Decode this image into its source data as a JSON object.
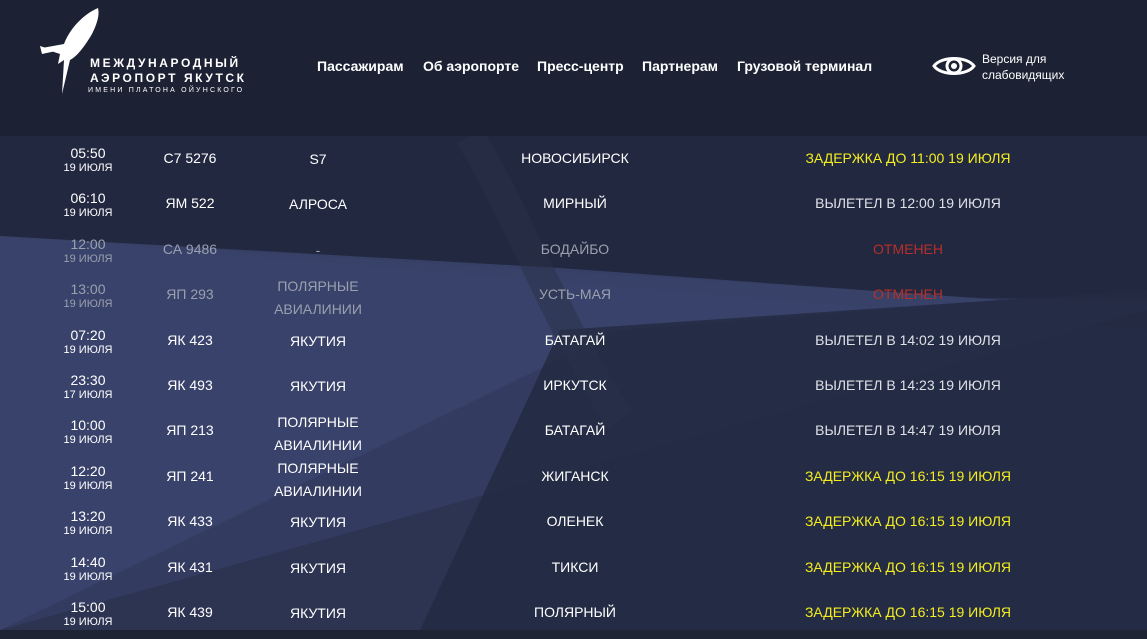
{
  "header": {
    "logo": {
      "line1": "МЕЖДУНАРОДНЫЙ",
      "line2": "АЭРОПОРТ ЯКУТСК",
      "line3": "ИМЕНИ ПЛАТОНА ОЙУНСКОГО"
    },
    "nav": [
      {
        "label": "Пассажирам"
      },
      {
        "label": "Об аэропорте"
      },
      {
        "label": "Пресс-центр"
      },
      {
        "label": "Партнерам"
      },
      {
        "label": "Грузовой терминал"
      }
    ],
    "accessibility": {
      "line1": "Версия для",
      "line2": "слабовидящих",
      "icon": "eye-icon"
    }
  },
  "colors": {
    "background": "#1f2435",
    "header": "#1c2133",
    "delay": "#f4ee1f",
    "cancelled": "#b5302a",
    "departed": "#dfe1e7"
  },
  "flights": [
    {
      "time": "05:50",
      "date": "19 ИЮЛЯ",
      "flight": "С7 5276",
      "airline": [
        "S7"
      ],
      "destination": "НОВОСИБИРСК",
      "status": "ЗАДЕРЖКА ДО 11:00 19 ИЮЛЯ",
      "status_type": "delay"
    },
    {
      "time": "06:10",
      "date": "19 ИЮЛЯ",
      "flight": "ЯМ 522",
      "airline": [
        "АЛРОСА"
      ],
      "destination": "МИРНЫЙ",
      "status": "ВЫЛЕТЕЛ В 12:00 19 ИЮЛЯ",
      "status_type": "done"
    },
    {
      "time": "12:00",
      "date": "19 ИЮЛЯ",
      "flight": "СА 9486",
      "airline": [
        "-"
      ],
      "destination": "БОДАЙБО",
      "status": "ОТМЕНЕН",
      "status_type": "cancel"
    },
    {
      "time": "13:00",
      "date": "19 ИЮЛЯ",
      "flight": "ЯП 293",
      "airline": [
        "ПОЛЯРНЫЕ",
        "АВИАЛИНИИ"
      ],
      "destination": "УСТЬ-МАЯ",
      "status": "ОТМЕНЕН",
      "status_type": "cancel"
    },
    {
      "time": "07:20",
      "date": "19 ИЮЛЯ",
      "flight": "ЯК 423",
      "airline": [
        "ЯКУТИЯ"
      ],
      "destination": "БАТАГАЙ",
      "status": "ВЫЛЕТЕЛ В 14:02 19 ИЮЛЯ",
      "status_type": "done"
    },
    {
      "time": "23:30",
      "date": "17 ИЮЛЯ",
      "flight": "ЯК 493",
      "airline": [
        "ЯКУТИЯ"
      ],
      "destination": "ИРКУТСК",
      "status": "ВЫЛЕТЕЛ В 14:23 19 ИЮЛЯ",
      "status_type": "done"
    },
    {
      "time": "10:00",
      "date": "19 ИЮЛЯ",
      "flight": "ЯП 213",
      "airline": [
        "ПОЛЯРНЫЕ",
        "АВИАЛИНИИ"
      ],
      "destination": "БАТАГАЙ",
      "status": "ВЫЛЕТЕЛ В 14:47 19 ИЮЛЯ",
      "status_type": "done"
    },
    {
      "time": "12:20",
      "date": "19 ИЮЛЯ",
      "flight": "ЯП 241",
      "airline": [
        "ПОЛЯРНЫЕ",
        "АВИАЛИНИИ"
      ],
      "destination": "ЖИГАНСК",
      "status": "ЗАДЕРЖКА ДО 16:15 19 ИЮЛЯ",
      "status_type": "delay"
    },
    {
      "time": "13:20",
      "date": "19 ИЮЛЯ",
      "flight": "ЯК 433",
      "airline": [
        "ЯКУТИЯ"
      ],
      "destination": "ОЛЕНЕК",
      "status": "ЗАДЕРЖКА ДО 16:15 19 ИЮЛЯ",
      "status_type": "delay"
    },
    {
      "time": "14:40",
      "date": "19 ИЮЛЯ",
      "flight": "ЯК 431",
      "airline": [
        "ЯКУТИЯ"
      ],
      "destination": "ТИКСИ",
      "status": "ЗАДЕРЖКА ДО 16:15 19 ИЮЛЯ",
      "status_type": "delay"
    },
    {
      "time": "15:00",
      "date": "19 ИЮЛЯ",
      "flight": "ЯК 439",
      "airline": [
        "ЯКУТИЯ"
      ],
      "destination": "ПОЛЯРНЫЙ",
      "status": "ЗАДЕРЖКА ДО 16:15 19 ИЮЛЯ",
      "status_type": "delay"
    }
  ]
}
